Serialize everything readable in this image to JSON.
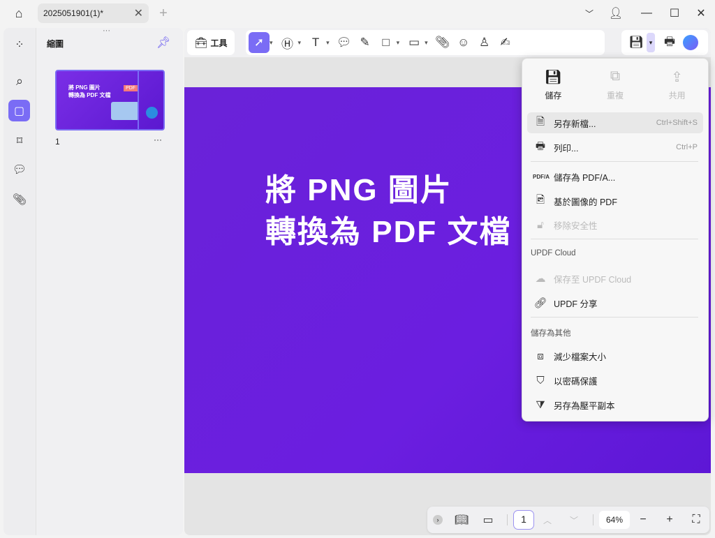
{
  "titlebar": {
    "tab_title": "2025051901(1)*",
    "close": "✕",
    "new_tab": "+"
  },
  "thumbnails": {
    "title": "縮圖",
    "page_number": "1",
    "more": "···",
    "thumb_line1": "將 PNG 圖片",
    "thumb_line2": "轉換為 PDF 文檔",
    "thumb_badge": "PDF"
  },
  "toolbar": {
    "tools_label": "工具"
  },
  "page": {
    "line1": "將 PNG 圖片",
    "line2": "轉換為 PDF 文檔"
  },
  "menu": {
    "top": [
      {
        "label": "儲存",
        "enabled": true
      },
      {
        "label": "重複",
        "enabled": false
      },
      {
        "label": "共用",
        "enabled": false
      }
    ],
    "save_as": {
      "label": "另存新檔...",
      "shortcut": "Ctrl+Shift+S"
    },
    "print": {
      "label": "列印...",
      "shortcut": "Ctrl+P"
    },
    "save_pdfa": "儲存為 PDF/A...",
    "image_pdf": "基於圖像的 PDF",
    "remove_security": "移除安全性",
    "cloud_section": "UPDF Cloud",
    "save_cloud": "保存至 UPDF Cloud",
    "share": "UPDF 分享",
    "other_section": "儲存為其他",
    "reduce": "減少檔案大小",
    "protect": "以密碼保護",
    "flatten": "另存為壓平副本"
  },
  "bottombar": {
    "page_input": "1",
    "zoom": "64%"
  },
  "colors": {
    "accent": "#7a6cf5",
    "page_bg": "#6a22d8"
  }
}
